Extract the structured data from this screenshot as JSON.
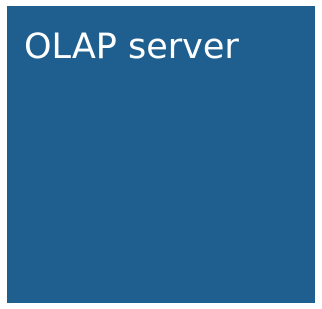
{
  "box": {
    "title": "OLAP server",
    "fill_color": "#1f5f8f",
    "text_color": "#ffffff"
  }
}
